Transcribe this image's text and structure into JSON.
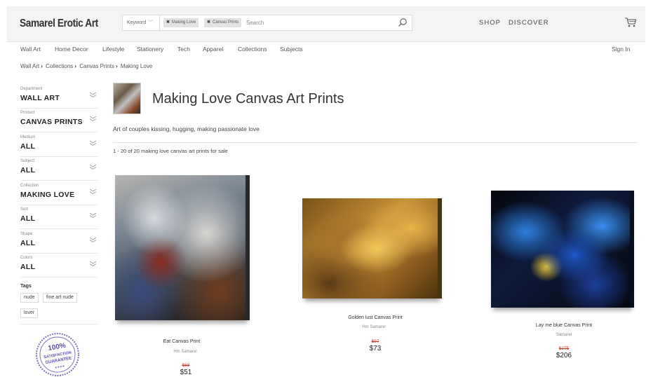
{
  "header": {
    "logo": "Samarel Erotic Art",
    "search": {
      "keyword_label": "Keyword",
      "chips": [
        "Making Love",
        "Canvas Prints"
      ],
      "placeholder": "Search"
    },
    "nav": [
      "SHOP",
      "DISCOVER"
    ]
  },
  "category_nav": [
    "Wall Art",
    "Home Decor",
    "Lifestyle",
    "Stationery",
    "Tech",
    "Apparel",
    "Collections",
    "Subjects"
  ],
  "sign_in": "Sign In",
  "breadcrumb": [
    "Wall Art",
    "Collections",
    "Canvas Prints",
    "Making Love"
  ],
  "breadcrumb_sep": "›",
  "filters": [
    {
      "label": "Department",
      "value": "WALL ART"
    },
    {
      "label": "Product",
      "value": "CANVAS PRINTS"
    },
    {
      "label": "Medium",
      "value": "ALL"
    },
    {
      "label": "Subject",
      "value": "ALL"
    },
    {
      "label": "Collection",
      "value": "MAKING LOVE"
    },
    {
      "label": "Sort",
      "value": "ALL"
    },
    {
      "label": "Shape",
      "value": "ALL"
    },
    {
      "label": "Colors",
      "value": "ALL"
    }
  ],
  "tags": {
    "title": "Tags",
    "items": [
      "nude",
      "fine art nude",
      "lover"
    ]
  },
  "badge": {
    "line1": "100%",
    "line2": "SATISFACTION",
    "line3": "GUARANTEE"
  },
  "main": {
    "title": "Making Love Canvas Art Prints",
    "description": "Art of couples kissing, hugging, making passionate love",
    "count": "1 - 20 of 20 making love canvas art prints for sale"
  },
  "products": [
    {
      "title": "Eat Canvas Print",
      "artist": "Hm Samarel",
      "old_price": "$68",
      "price": "$51"
    },
    {
      "title": "Golden lust Canvas Print",
      "artist": "Hm Samarel",
      "old_price": "$97",
      "price": "$73"
    },
    {
      "title": "Lay me blue Canvas Print",
      "artist": "Samarel",
      "old_price": "$275",
      "price": "$206"
    }
  ]
}
